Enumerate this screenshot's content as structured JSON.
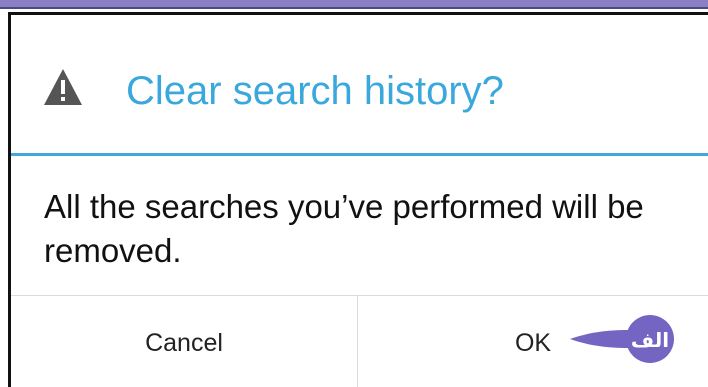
{
  "dialog": {
    "title": "Clear search history?",
    "title_icon": "warning-icon",
    "message": "All the searches you’ve performed will be removed.",
    "buttons": {
      "cancel_label": "Cancel",
      "ok_label": "OK"
    }
  },
  "annotation": {
    "label": "الف",
    "icon": "arrow-marker-icon"
  },
  "colors": {
    "title": "#3aa8dc",
    "divider": "#44a7d9",
    "warning_icon": "#555555",
    "marker": "#7565c2",
    "top_border": "#8a80c4"
  }
}
